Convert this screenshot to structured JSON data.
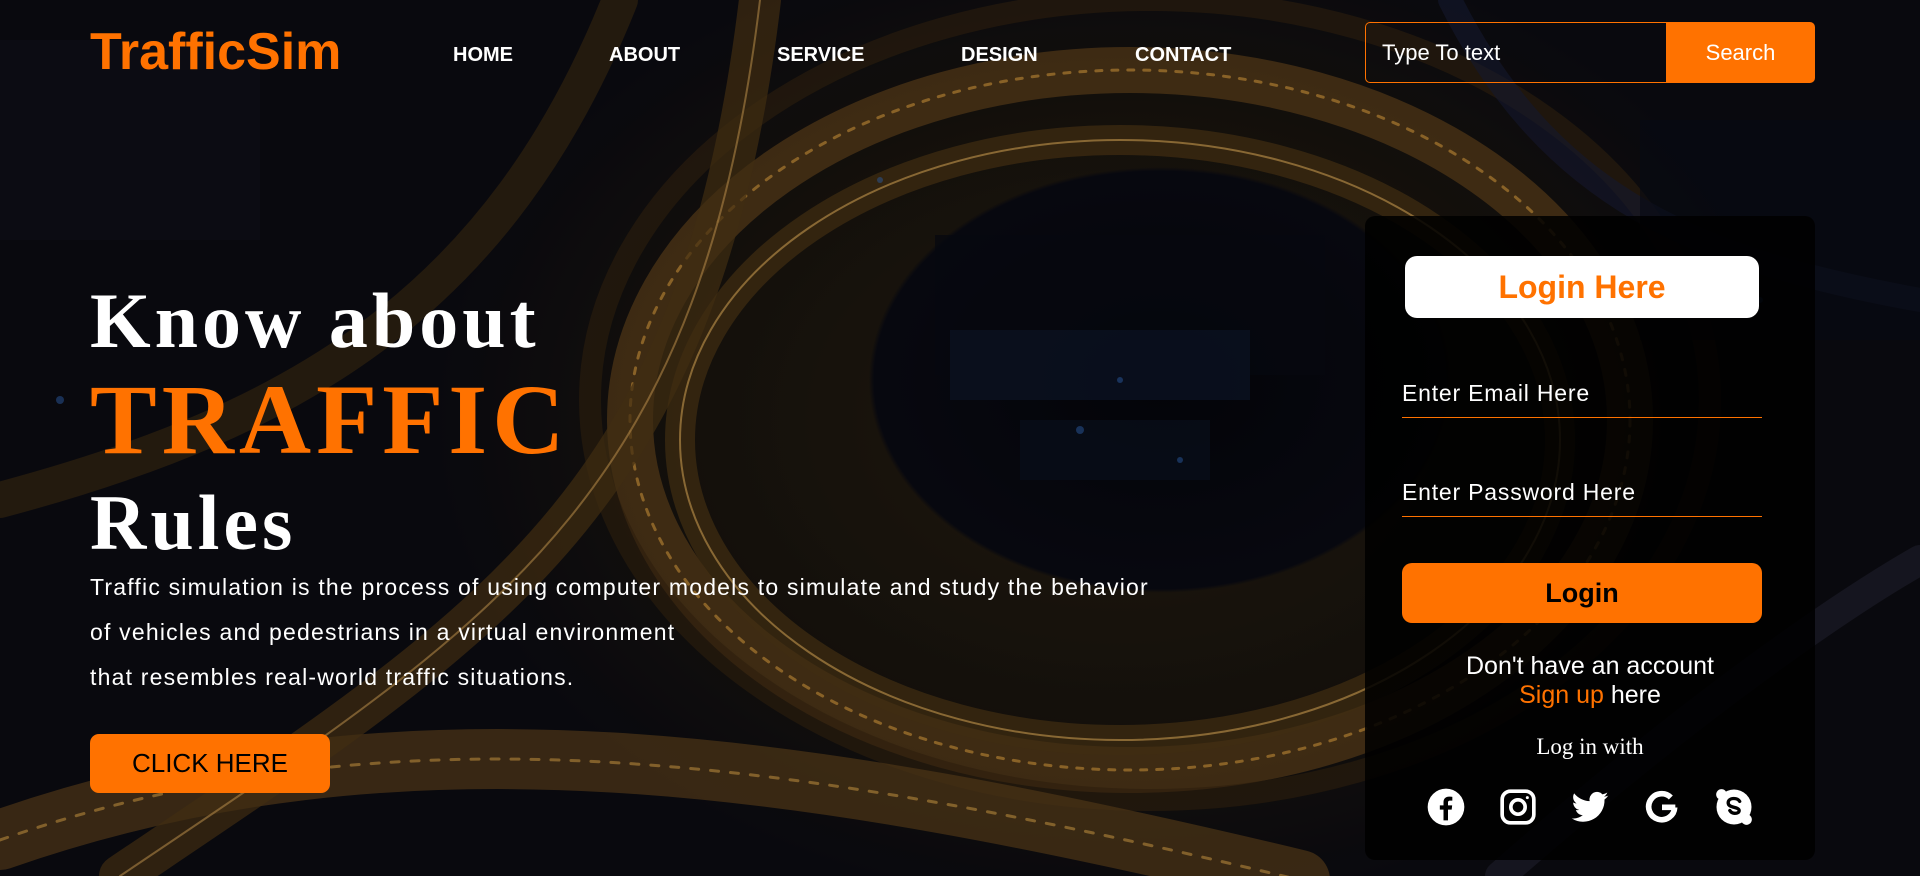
{
  "header": {
    "logo": "TrafficSim",
    "nav": [
      "HOME",
      "ABOUT",
      "SERVICE",
      "DESIGN",
      "CONTACT"
    ],
    "search_placeholder": "Type To text",
    "search_button": "Search"
  },
  "hero": {
    "line1": "Know about",
    "line2": "TRAFFIC",
    "line3": "Rules",
    "paragraph": [
      "Traffic simulation is the process of using computer models to simulate and study the behavior",
      "of vehicles and pedestrians in a virtual environment",
      "that resembles real-world traffic situations."
    ],
    "cta": "CLICK HERE"
  },
  "login": {
    "title": "Login Here",
    "email_placeholder": "Enter Email Here",
    "password_placeholder": "Enter Password Here",
    "button": "Login",
    "no_account": "Don't have an account",
    "signup_link": "Sign up",
    "signup_suffix": " here",
    "login_with": "Log in with",
    "socials": [
      "facebook-icon",
      "instagram-icon",
      "twitter-icon",
      "google-icon",
      "skype-icon"
    ]
  },
  "colors": {
    "accent": "#ff7200",
    "text": "#ffffff"
  }
}
